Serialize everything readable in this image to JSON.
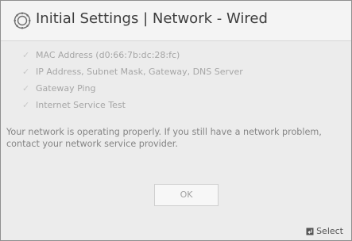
{
  "dialog": {
    "title": "Initial Settings | Network - Wired",
    "checks": [
      {
        "label": "MAC Address (d0:66:7b:dc:28:fc)"
      },
      {
        "label": "IP Address, Subnet Mask, Gateway, DNS Server"
      },
      {
        "label": "Gateway Ping"
      },
      {
        "label": "Internet Service Test"
      }
    ],
    "status_message": "Your network is operating properly. If you still have a network problem, contact your network service provider.",
    "ok_label": "OK",
    "select_label": "Select"
  },
  "icons": {
    "title_icon": "gear-icon",
    "check_icon": "checkmark-icon",
    "select_icon": "enter-key-icon"
  }
}
